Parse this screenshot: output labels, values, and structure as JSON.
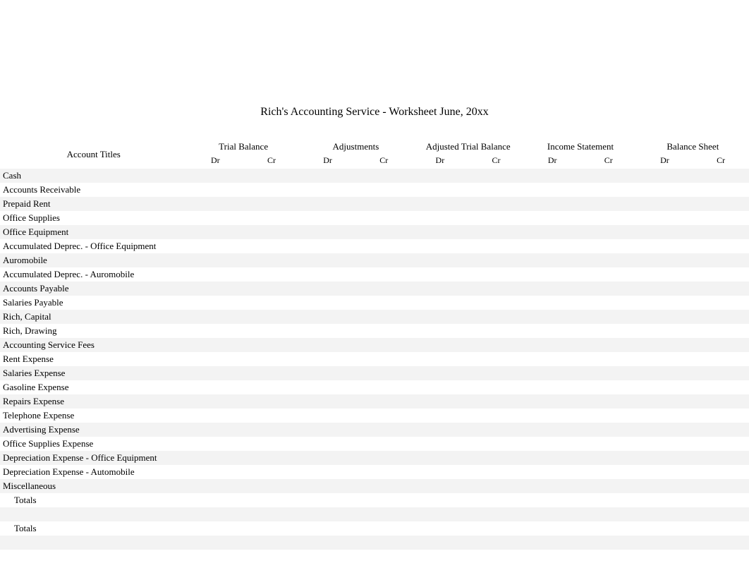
{
  "title": "Rich's Accounting Service - Worksheet June, 20xx",
  "headers": {
    "account": "Account Titles",
    "groups": [
      "Trial Balance",
      "Adjustments",
      "Adjusted Trial Balance",
      "Income Statement",
      "Balance Sheet"
    ],
    "dr": "Dr",
    "cr": "Cr"
  },
  "accounts": [
    "Cash",
    "Accounts Receivable",
    "Prepaid Rent",
    "Office Supplies",
    "Office Equipment",
    "Accumulated Deprec. - Office Equipment",
    "Auromobile",
    "Accumulated Deprec. - Auromobile",
    "Accounts Payable",
    "Salaries Payable",
    "Rich, Capital",
    "Rich, Drawing",
    "Accounting Service Fees",
    "Rent Expense",
    "Salaries Expense",
    "Gasoline    Expense",
    "Repairs Expense",
    "Telephone Expense",
    "Advertising Expense",
    "Office Supplies Expense",
    "Depreciation Expense - Office Equipment",
    "Depreciation Expense - Automobile",
    "Miscellaneous"
  ],
  "totals_label": "Totals",
  "chart_data": {
    "type": "table",
    "title": "Rich's Accounting Service - Worksheet June, 20xx",
    "columns": [
      "Account Titles",
      "Trial Balance Dr",
      "Trial Balance Cr",
      "Adjustments Dr",
      "Adjustments Cr",
      "Adjusted Trial Balance Dr",
      "Adjusted Trial Balance Cr",
      "Income Statement Dr",
      "Income Statement Cr",
      "Balance Sheet Dr",
      "Balance Sheet Cr"
    ],
    "rows": [
      [
        "Cash",
        "",
        "",
        "",
        "",
        "",
        "",
        "",
        "",
        "",
        ""
      ],
      [
        "Accounts Receivable",
        "",
        "",
        "",
        "",
        "",
        "",
        "",
        "",
        "",
        ""
      ],
      [
        "Prepaid Rent",
        "",
        "",
        "",
        "",
        "",
        "",
        "",
        "",
        "",
        ""
      ],
      [
        "Office Supplies",
        "",
        "",
        "",
        "",
        "",
        "",
        "",
        "",
        "",
        ""
      ],
      [
        "Office Equipment",
        "",
        "",
        "",
        "",
        "",
        "",
        "",
        "",
        "",
        ""
      ],
      [
        "Accumulated Deprec. - Office Equipment",
        "",
        "",
        "",
        "",
        "",
        "",
        "",
        "",
        "",
        ""
      ],
      [
        "Auromobile",
        "",
        "",
        "",
        "",
        "",
        "",
        "",
        "",
        "",
        ""
      ],
      [
        "Accumulated Deprec. - Auromobile",
        "",
        "",
        "",
        "",
        "",
        "",
        "",
        "",
        "",
        ""
      ],
      [
        "Accounts Payable",
        "",
        "",
        "",
        "",
        "",
        "",
        "",
        "",
        "",
        ""
      ],
      [
        "Salaries Payable",
        "",
        "",
        "",
        "",
        "",
        "",
        "",
        "",
        "",
        ""
      ],
      [
        "Rich, Capital",
        "",
        "",
        "",
        "",
        "",
        "",
        "",
        "",
        "",
        ""
      ],
      [
        "Rich, Drawing",
        "",
        "",
        "",
        "",
        "",
        "",
        "",
        "",
        "",
        ""
      ],
      [
        "Accounting Service Fees",
        "",
        "",
        "",
        "",
        "",
        "",
        "",
        "",
        "",
        ""
      ],
      [
        "Rent Expense",
        "",
        "",
        "",
        "",
        "",
        "",
        "",
        "",
        "",
        ""
      ],
      [
        "Salaries Expense",
        "",
        "",
        "",
        "",
        "",
        "",
        "",
        "",
        "",
        ""
      ],
      [
        "Gasoline    Expense",
        "",
        "",
        "",
        "",
        "",
        "",
        "",
        "",
        "",
        ""
      ],
      [
        "Repairs Expense",
        "",
        "",
        "",
        "",
        "",
        "",
        "",
        "",
        "",
        ""
      ],
      [
        "Telephone Expense",
        "",
        "",
        "",
        "",
        "",
        "",
        "",
        "",
        "",
        ""
      ],
      [
        "Advertising Expense",
        "",
        "",
        "",
        "",
        "",
        "",
        "",
        "",
        "",
        ""
      ],
      [
        "Office Supplies Expense",
        "",
        "",
        "",
        "",
        "",
        "",
        "",
        "",
        "",
        ""
      ],
      [
        "Depreciation Expense - Office Equipment",
        "",
        "",
        "",
        "",
        "",
        "",
        "",
        "",
        "",
        ""
      ],
      [
        "Depreciation Expense - Automobile",
        "",
        "",
        "",
        "",
        "",
        "",
        "",
        "",
        "",
        ""
      ],
      [
        "Miscellaneous",
        "",
        "",
        "",
        "",
        "",
        "",
        "",
        "",
        "",
        ""
      ],
      [
        "Totals",
        "",
        "",
        "",
        "",
        "",
        "",
        "",
        "",
        "",
        ""
      ],
      [
        "",
        "",
        "",
        "",
        "",
        "",
        "",
        "",
        "",
        "",
        ""
      ],
      [
        "Totals",
        "",
        "",
        "",
        "",
        "",
        "",
        "",
        "",
        "",
        ""
      ]
    ]
  }
}
